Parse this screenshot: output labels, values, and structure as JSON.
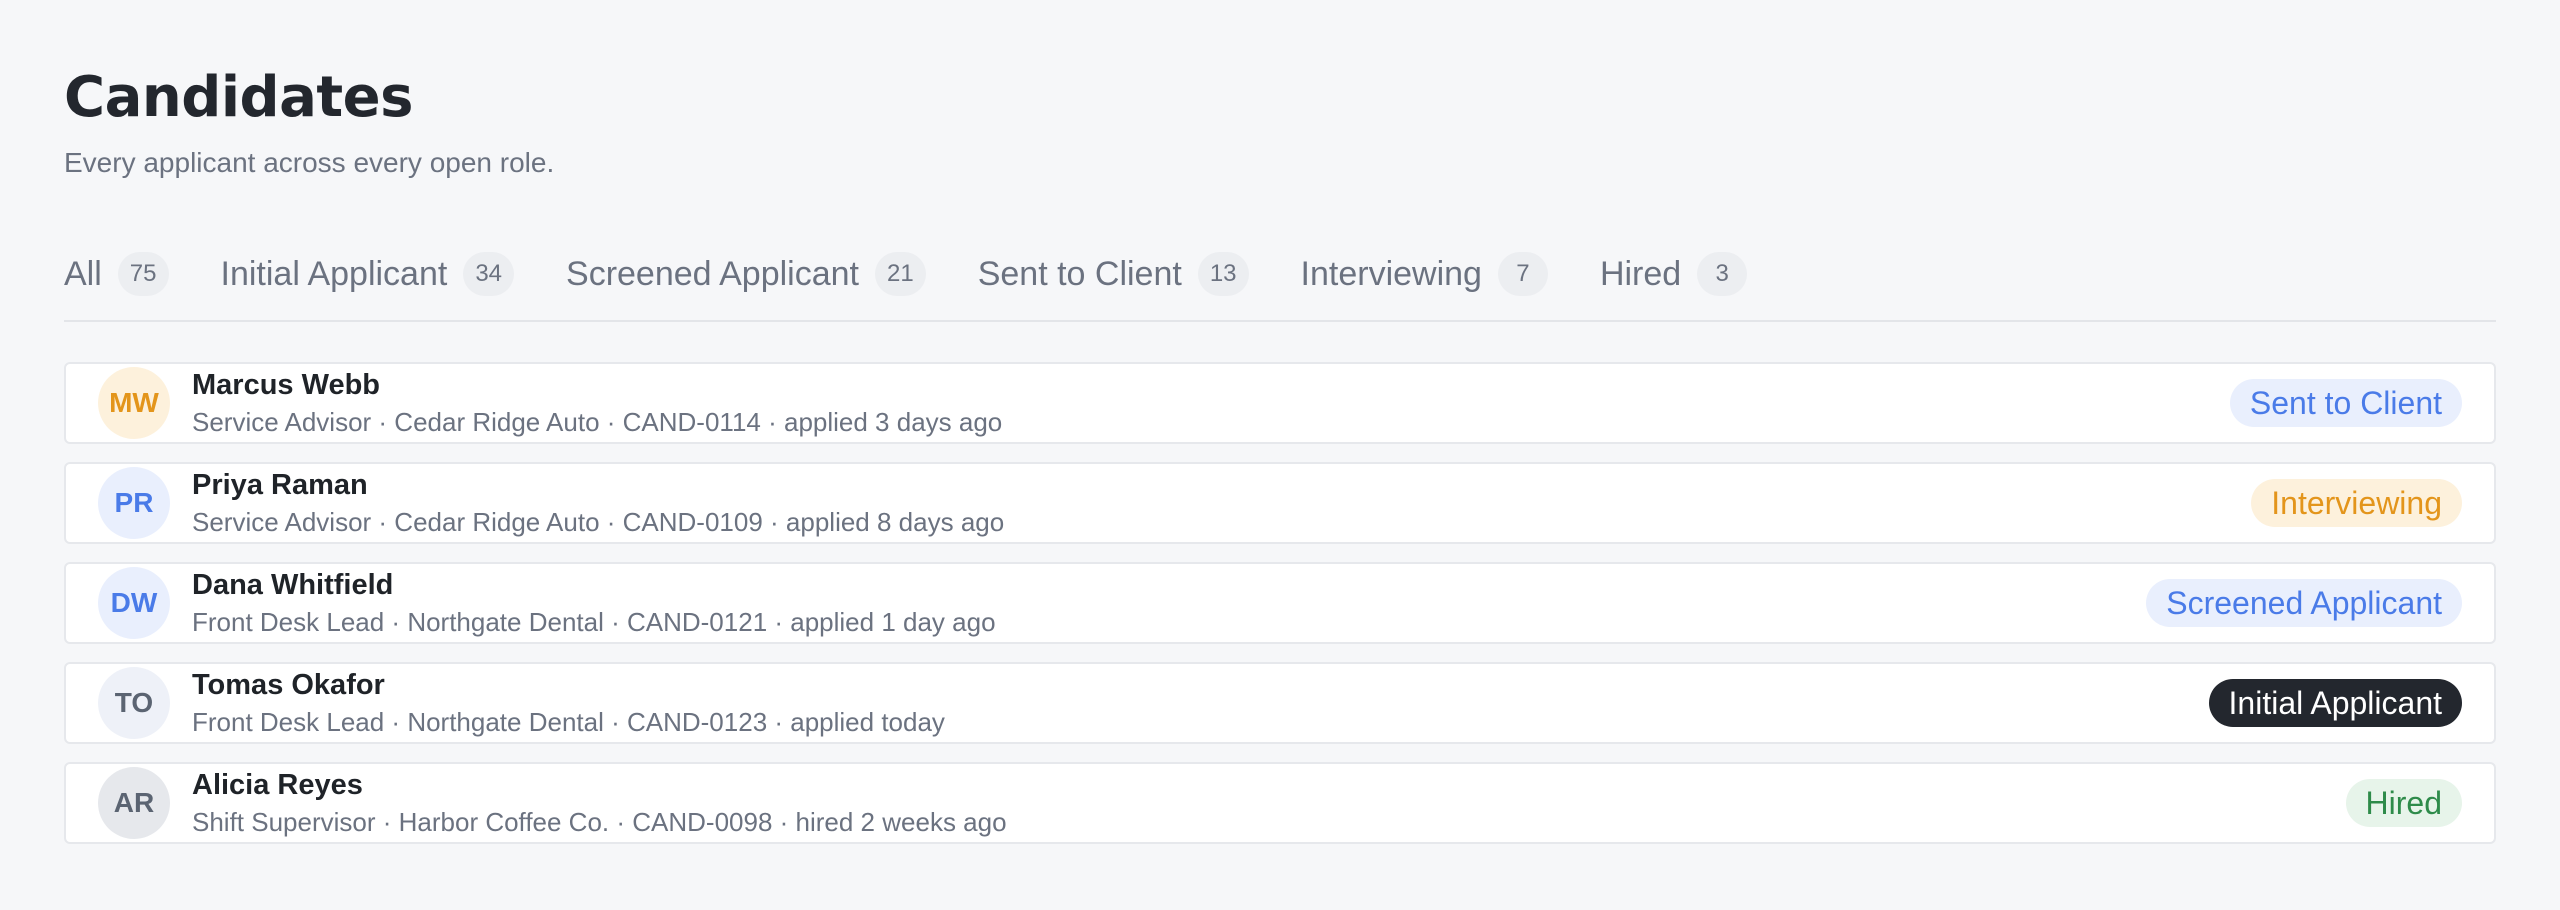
{
  "header": {
    "title": "Candidates",
    "subtitle": "Every applicant across every open role."
  },
  "tabs": [
    {
      "label": "All",
      "count": "75"
    },
    {
      "label": "Initial Applicant",
      "count": "34"
    },
    {
      "label": "Screened Applicant",
      "count": "21"
    },
    {
      "label": "Sent to Client",
      "count": "13"
    },
    {
      "label": "Interviewing",
      "count": "7"
    },
    {
      "label": "Hired",
      "count": "3"
    }
  ],
  "candidates": [
    {
      "initials": "MW",
      "name": "Marcus Webb",
      "meta": "Service Advisor · Cedar Ridge Auto · CAND-0114 · applied 3 days ago",
      "status": "Sent to Client",
      "avatar_bg": "#fdf1dc",
      "avatar_fg": "#e3951b"
    },
    {
      "initials": "PR",
      "name": "Priya Raman",
      "meta": "Service Advisor · Cedar Ridge Auto · CAND-0109 · applied 8 days ago",
      "status": "Interviewing",
      "avatar_bg": "#e9effd",
      "avatar_fg": "#4a7be8"
    },
    {
      "initials": "DW",
      "name": "Dana Whitfield",
      "meta": "Front Desk Lead · Northgate Dental · CAND-0121 · applied 1 day ago",
      "status": "Screened Applicant",
      "avatar_bg": "#e9effd",
      "avatar_fg": "#4a7be8"
    },
    {
      "initials": "TO",
      "name": "Tomas Okafor",
      "meta": "Front Desk Lead · Northgate Dental · CAND-0123 · applied today",
      "status": "Initial Applicant",
      "avatar_bg": "#eef1f8",
      "avatar_fg": "#5b6472"
    },
    {
      "initials": "AR",
      "name": "Alicia Reyes",
      "meta": "Shift Supervisor · Harbor Coffee Co. · CAND-0098 · hired 2 weeks ago",
      "status": "Hired",
      "avatar_bg": "#e6e8ec",
      "avatar_fg": "#5b6472"
    }
  ]
}
